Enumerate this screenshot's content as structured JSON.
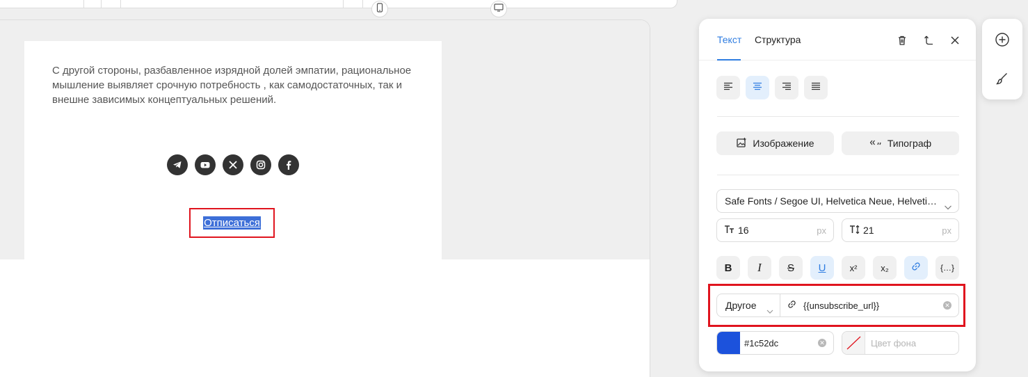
{
  "email": {
    "paragraph": "С другой стороны, разбавленное изрядной долей эмпатии, рациональное мышление выявляет срочную потребность , как самодостаточных, так и внешне зависимых концептуальных решений.",
    "social_icons": [
      "telegram-icon",
      "youtube-icon",
      "x-icon",
      "instagram-icon",
      "facebook-icon"
    ],
    "unsubscribe_link": "Отписаться"
  },
  "panel": {
    "tabs": {
      "text": "Текст",
      "structure": "Структура"
    },
    "buttons": {
      "image": "Изображение",
      "typograf": "Типограф"
    },
    "font_family": "Safe Fonts / Segoe UI, Helvetica Neue, Helvetica, Arial, sans-serif",
    "font_size": {
      "value": "16",
      "unit": "px"
    },
    "line_height": {
      "value": "21",
      "unit": "px"
    },
    "format_buttons": [
      "B",
      "I",
      "S",
      "U",
      "x²",
      "x₂",
      "link",
      "{…}"
    ],
    "link": {
      "type": "Другое",
      "url": "{{unsubscribe_url}}"
    },
    "text_color": "#1c52dc",
    "bg_color_placeholder": "Цвет фона"
  },
  "colors": {
    "accent": "#2f7de1",
    "highlight": "#e0141e",
    "text_color_swatch": "#1c52dc"
  }
}
